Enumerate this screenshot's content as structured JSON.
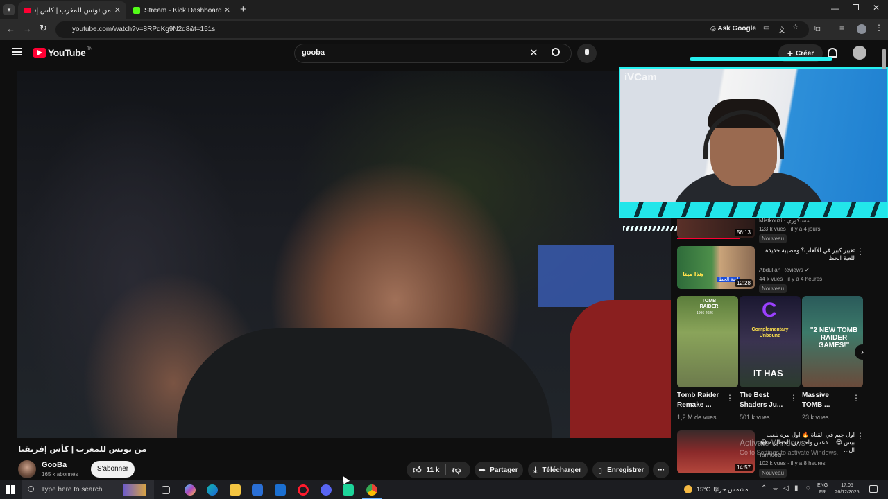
{
  "browser": {
    "tabs": [
      {
        "label": "من تونس للمغرب | كأس إفريقيا",
        "active": true
      },
      {
        "label": "Stream - Kick Dashboard",
        "active": false
      }
    ],
    "url": "youtube.com/watch?v=8RPqKg9N2q8&t=151s",
    "ask_google": "Ask Google"
  },
  "youtube": {
    "logo_text": "YouTube",
    "logo_sup": "TN",
    "search_value": "gooba",
    "create_label": "Créer"
  },
  "camera": {
    "watermark": "iVCam"
  },
  "video": {
    "title": "من تونس للمغرب | كأس إفريقيا",
    "channel": "GooBa",
    "subscribers": "165 k abonnés",
    "subscribe_label": "S'abonner",
    "likes": "11 k",
    "share_label": "Partager",
    "download_label": "Télécharger",
    "save_label": "Enregistrer"
  },
  "sidebar": {
    "rec1": {
      "channel": "Mistkouzi · مستكوزي",
      "meta": "123 k vues · il y a 4 jours",
      "duration": "56:13",
      "badge": "Nouveau"
    },
    "rec2": {
      "title": "تغيير كبير في الألعاب؟ ومصيبة جديدة للعبة الحظ",
      "channel": "Abdullah Reviews",
      "meta": "44 k vues · il y a 4 heures",
      "duration": "12:28",
      "badge": "Nouveau",
      "thumb_text_1": "هذا ميتا",
      "thumb_text_2": "لعبة الحظ"
    },
    "shorts": [
      {
        "title": "Tomb Raider Remake ...",
        "views": "1,2 M de vues",
        "thumb_text": "TOMB RAIDER",
        "thumb_sub": "1996-2026"
      },
      {
        "title": "The Best Shaders Ju...",
        "views": "501 k vues",
        "thumb_text": "IT HAS",
        "thumb_sub": "Complementary Unbound"
      },
      {
        "title": "Massive TOMB ...",
        "views": "23 k vues",
        "thumb_text": "\"2 NEW TOMB RAIDER GAMES!\""
      }
    ],
    "rec3": {
      "title": "اول جيم في القناة 🔥 اول مره نلعب بيس 😎 ... دعس واحد من الخطاربة 😂 ال...",
      "channel": "Tarmoozi",
      "meta": "102 k vues · il y a 8 heures",
      "duration": "14:57",
      "badge": "Nouveau"
    }
  },
  "windows_watermark": {
    "line1": "Activate Windows",
    "line2": "Go to Settings to activate Windows."
  },
  "taskbar": {
    "search_placeholder": "Type here to search",
    "weather": "15°C",
    "weather_text": "مشمس جزئيًا",
    "lang_top": "ENG",
    "lang_bottom": "FR",
    "time": "17:05",
    "date": "26/12/2025"
  },
  "colors": {
    "cam_border": "#26f0f0",
    "yt_red": "#ff0033",
    "kick_green": "#53fc18"
  }
}
